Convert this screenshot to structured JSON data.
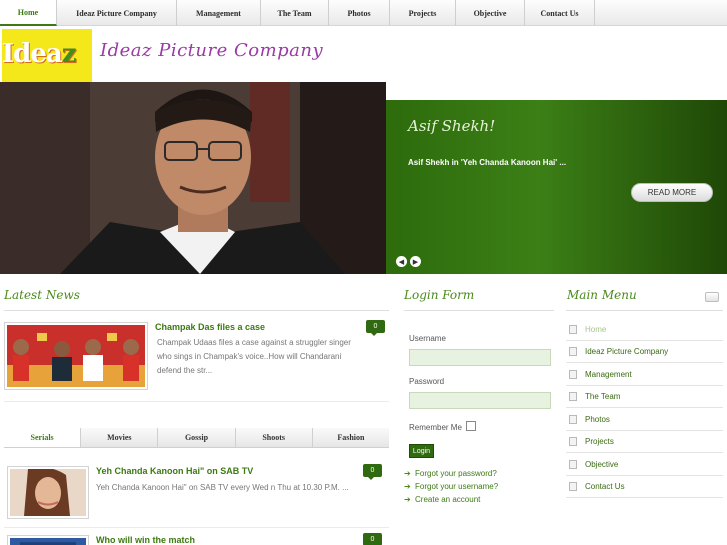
{
  "nav": {
    "items": [
      {
        "label": "Home"
      },
      {
        "label": "Ideaz Picture Company"
      },
      {
        "label": "Management"
      },
      {
        "label": "The Team"
      },
      {
        "label": "Photos"
      },
      {
        "label": "Projects"
      },
      {
        "label": "Objective"
      },
      {
        "label": "Contact Us"
      }
    ]
  },
  "header": {
    "logo_text_a": "Idea",
    "logo_text_b": "z",
    "site_title": "Ideaz Picture Company"
  },
  "slider": {
    "title": "Asif Shekh!",
    "caption": "Asif Shekh in 'Yeh Chanda Kanoon Hai' ...",
    "read_more": "READ MORE",
    "prev_glyph": "◀",
    "next_glyph": "▶"
  },
  "latest_news": {
    "heading": "Latest News",
    "featured": {
      "title": "Champak Das files a case",
      "comments": "0",
      "text_line1": "Champak Udaas files a case against a struggler singer",
      "text_line2": "who sings in Champak's voice..How will Chandarani",
      "text_line3": "defend the str..."
    },
    "tabs": [
      {
        "label": "Serials"
      },
      {
        "label": "Movies"
      },
      {
        "label": "Gossip"
      },
      {
        "label": "Shoots"
      },
      {
        "label": "Fashion"
      }
    ],
    "items": [
      {
        "title": "Yeh Chanda Kanoon Hai\" on SAB TV",
        "comments": "0",
        "text": "Yeh Chanda Kanoon Hai\" on SAB TV every Wed n Thu at 10.30 P.M. ..."
      },
      {
        "title": "Who will win the match",
        "comments": "0"
      }
    ]
  },
  "login": {
    "heading": "Login Form",
    "username_label": "Username",
    "password_label": "Password",
    "remember_label": "Remember Me",
    "button": "Login",
    "links": [
      {
        "label": "Forgot your password?"
      },
      {
        "label": "Forgot your username?"
      },
      {
        "label": "Create an account"
      }
    ],
    "arrow_glyph": "➔"
  },
  "main_menu": {
    "heading": "Main Menu",
    "items": [
      {
        "label": "Home"
      },
      {
        "label": "Ideaz Picture Company"
      },
      {
        "label": "Management"
      },
      {
        "label": "The Team"
      },
      {
        "label": "Photos"
      },
      {
        "label": "Projects"
      },
      {
        "label": "Objective"
      },
      {
        "label": "Contact Us"
      }
    ]
  },
  "colors": {
    "accent_green": "#3d7a14",
    "title_purple": "#9a3aa5",
    "logo_yellow": "#f4e71a"
  }
}
